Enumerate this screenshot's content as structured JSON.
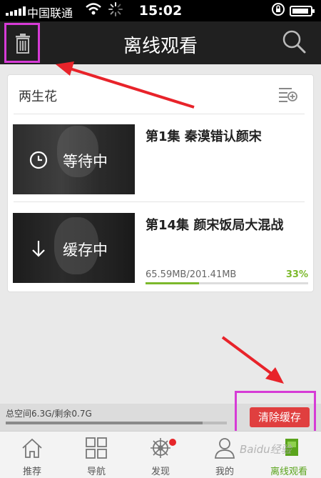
{
  "status_bar": {
    "carrier": "中国联通",
    "time": "15:02"
  },
  "header": {
    "title": "离线观看",
    "trash_icon": "trash-icon",
    "search_icon": "search-icon"
  },
  "card": {
    "series_title": "两生花",
    "add_queue_icon": "playlist-add-icon",
    "episodes": [
      {
        "title": "第1集 秦漠错认颜宋",
        "status": "等待中",
        "status_icon": "clock-icon"
      },
      {
        "title": "第14集 颜宋饭局大混战",
        "status": "缓存中",
        "status_icon": "download-arrow-icon",
        "progress_text": "65.59MB/201.41MB",
        "progress_percent": "33%",
        "progress_fraction": 0.33
      }
    ]
  },
  "storage": {
    "info": "总空间6.3G/剩余0.7G",
    "used_fraction": 0.89,
    "clear_button": "清除缓存"
  },
  "tabbar": {
    "tabs": [
      {
        "label": "推荐",
        "icon": "home-icon"
      },
      {
        "label": "导航",
        "icon": "grid-icon"
      },
      {
        "label": "发现",
        "icon": "compass-icon"
      },
      {
        "label": "我的",
        "icon": "user-icon"
      },
      {
        "label": "离线观看",
        "icon": "offline-icon"
      }
    ],
    "watermark": "Baidu经验"
  },
  "colors": {
    "accent_green": "#7cb92c",
    "clear_red": "#e03f3f",
    "highlight_magenta": "#d63bd6",
    "header_bg": "#202020"
  }
}
